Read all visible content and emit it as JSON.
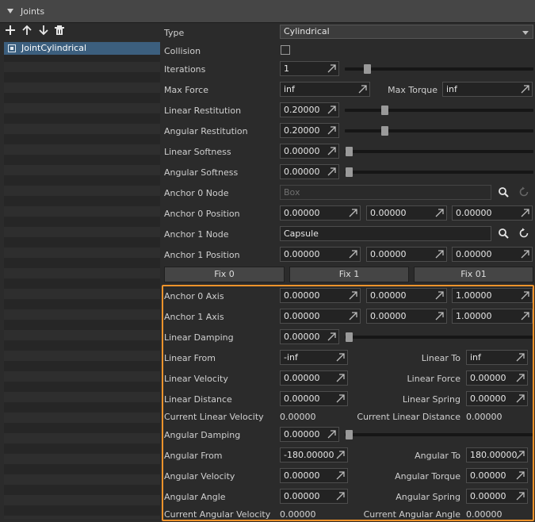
{
  "panel": {
    "title": "Joints"
  },
  "toolbar": {
    "icons": [
      "add-icon",
      "arrow-up-icon",
      "arrow-down-icon",
      "trash-icon"
    ]
  },
  "joints_list": {
    "items": [
      {
        "label": "JointCylindrical",
        "selected": true
      }
    ]
  },
  "props": {
    "type": {
      "label": "Type",
      "value": "Cylindrical"
    },
    "collision": {
      "label": "Collision",
      "checked": false
    },
    "iterations": {
      "label": "Iterations",
      "value": "1",
      "slider_fraction": 0.05
    },
    "max_force": {
      "label": "Max Force",
      "value": "inf"
    },
    "max_torque": {
      "label": "Max Torque",
      "value": "inf"
    },
    "linear_restitution": {
      "label": "Linear Restitution",
      "value": "0.20000",
      "slider_fraction": 0.2
    },
    "angular_restitution": {
      "label": "Angular Restitution",
      "value": "0.20000",
      "slider_fraction": 0.2
    },
    "linear_softness": {
      "label": "Linear Softness",
      "value": "0.00000",
      "slider_fraction": 0
    },
    "angular_softness": {
      "label": "Angular Softness",
      "value": "0.00000",
      "slider_fraction": 0
    },
    "anchor0_node": {
      "label": "Anchor 0 Node",
      "placeholder": "Box"
    },
    "anchor0_position": {
      "label": "Anchor 0 Position",
      "x": "0.00000",
      "y": "0.00000",
      "z": "0.00000"
    },
    "anchor1_node": {
      "label": "Anchor 1 Node",
      "value": "Capsule"
    },
    "anchor1_position": {
      "label": "Anchor 1 Position",
      "x": "0.00000",
      "y": "0.00000",
      "z": "0.00000"
    },
    "buttons": {
      "fix0": "Fix 0",
      "fix1": "Fix 1",
      "fix01": "Fix 01"
    },
    "anchor0_axis": {
      "label": "Anchor 0 Axis",
      "x": "0.00000",
      "y": "0.00000",
      "z": "1.00000"
    },
    "anchor1_axis": {
      "label": "Anchor 1 Axis",
      "x": "0.00000",
      "y": "0.00000",
      "z": "1.00000"
    },
    "linear_damping": {
      "label": "Linear Damping",
      "value": "0.00000",
      "slider_fraction": 0
    },
    "linear_from": {
      "label": "Linear From",
      "value": "-inf"
    },
    "linear_to": {
      "label": "Linear To",
      "value": "inf"
    },
    "linear_velocity": {
      "label": "Linear Velocity",
      "value": "0.00000"
    },
    "linear_force": {
      "label": "Linear Force",
      "value": "0.00000"
    },
    "linear_distance": {
      "label": "Linear Distance",
      "value": "0.00000"
    },
    "linear_spring": {
      "label": "Linear Spring",
      "value": "0.00000"
    },
    "current_linear_velocity": {
      "label": "Current Linear Velocity",
      "value": "0.00000"
    },
    "current_linear_distance": {
      "label": "Current Linear Distance",
      "value": "0.00000"
    },
    "angular_damping": {
      "label": "Angular Damping",
      "value": "0.00000",
      "slider_fraction": 0
    },
    "angular_from": {
      "label": "Angular From",
      "value": "-180.00000"
    },
    "angular_to": {
      "label": "Angular To",
      "value": "180.00000"
    },
    "angular_velocity": {
      "label": "Angular Velocity",
      "value": "0.00000"
    },
    "angular_torque": {
      "label": "Angular Torque",
      "value": "0.00000"
    },
    "angular_angle": {
      "label": "Angular Angle",
      "value": "0.00000"
    },
    "angular_spring": {
      "label": "Angular Spring",
      "value": "0.00000"
    },
    "current_angular_velocity": {
      "label": "Current Angular Velocity",
      "value": "0.00000"
    },
    "current_angular_angle": {
      "label": "Current Angular Angle",
      "value": "0.00000"
    }
  },
  "colors": {
    "highlight": "#f0932b",
    "selection": "#3c5f7e",
    "background": "#2b2b2b"
  }
}
